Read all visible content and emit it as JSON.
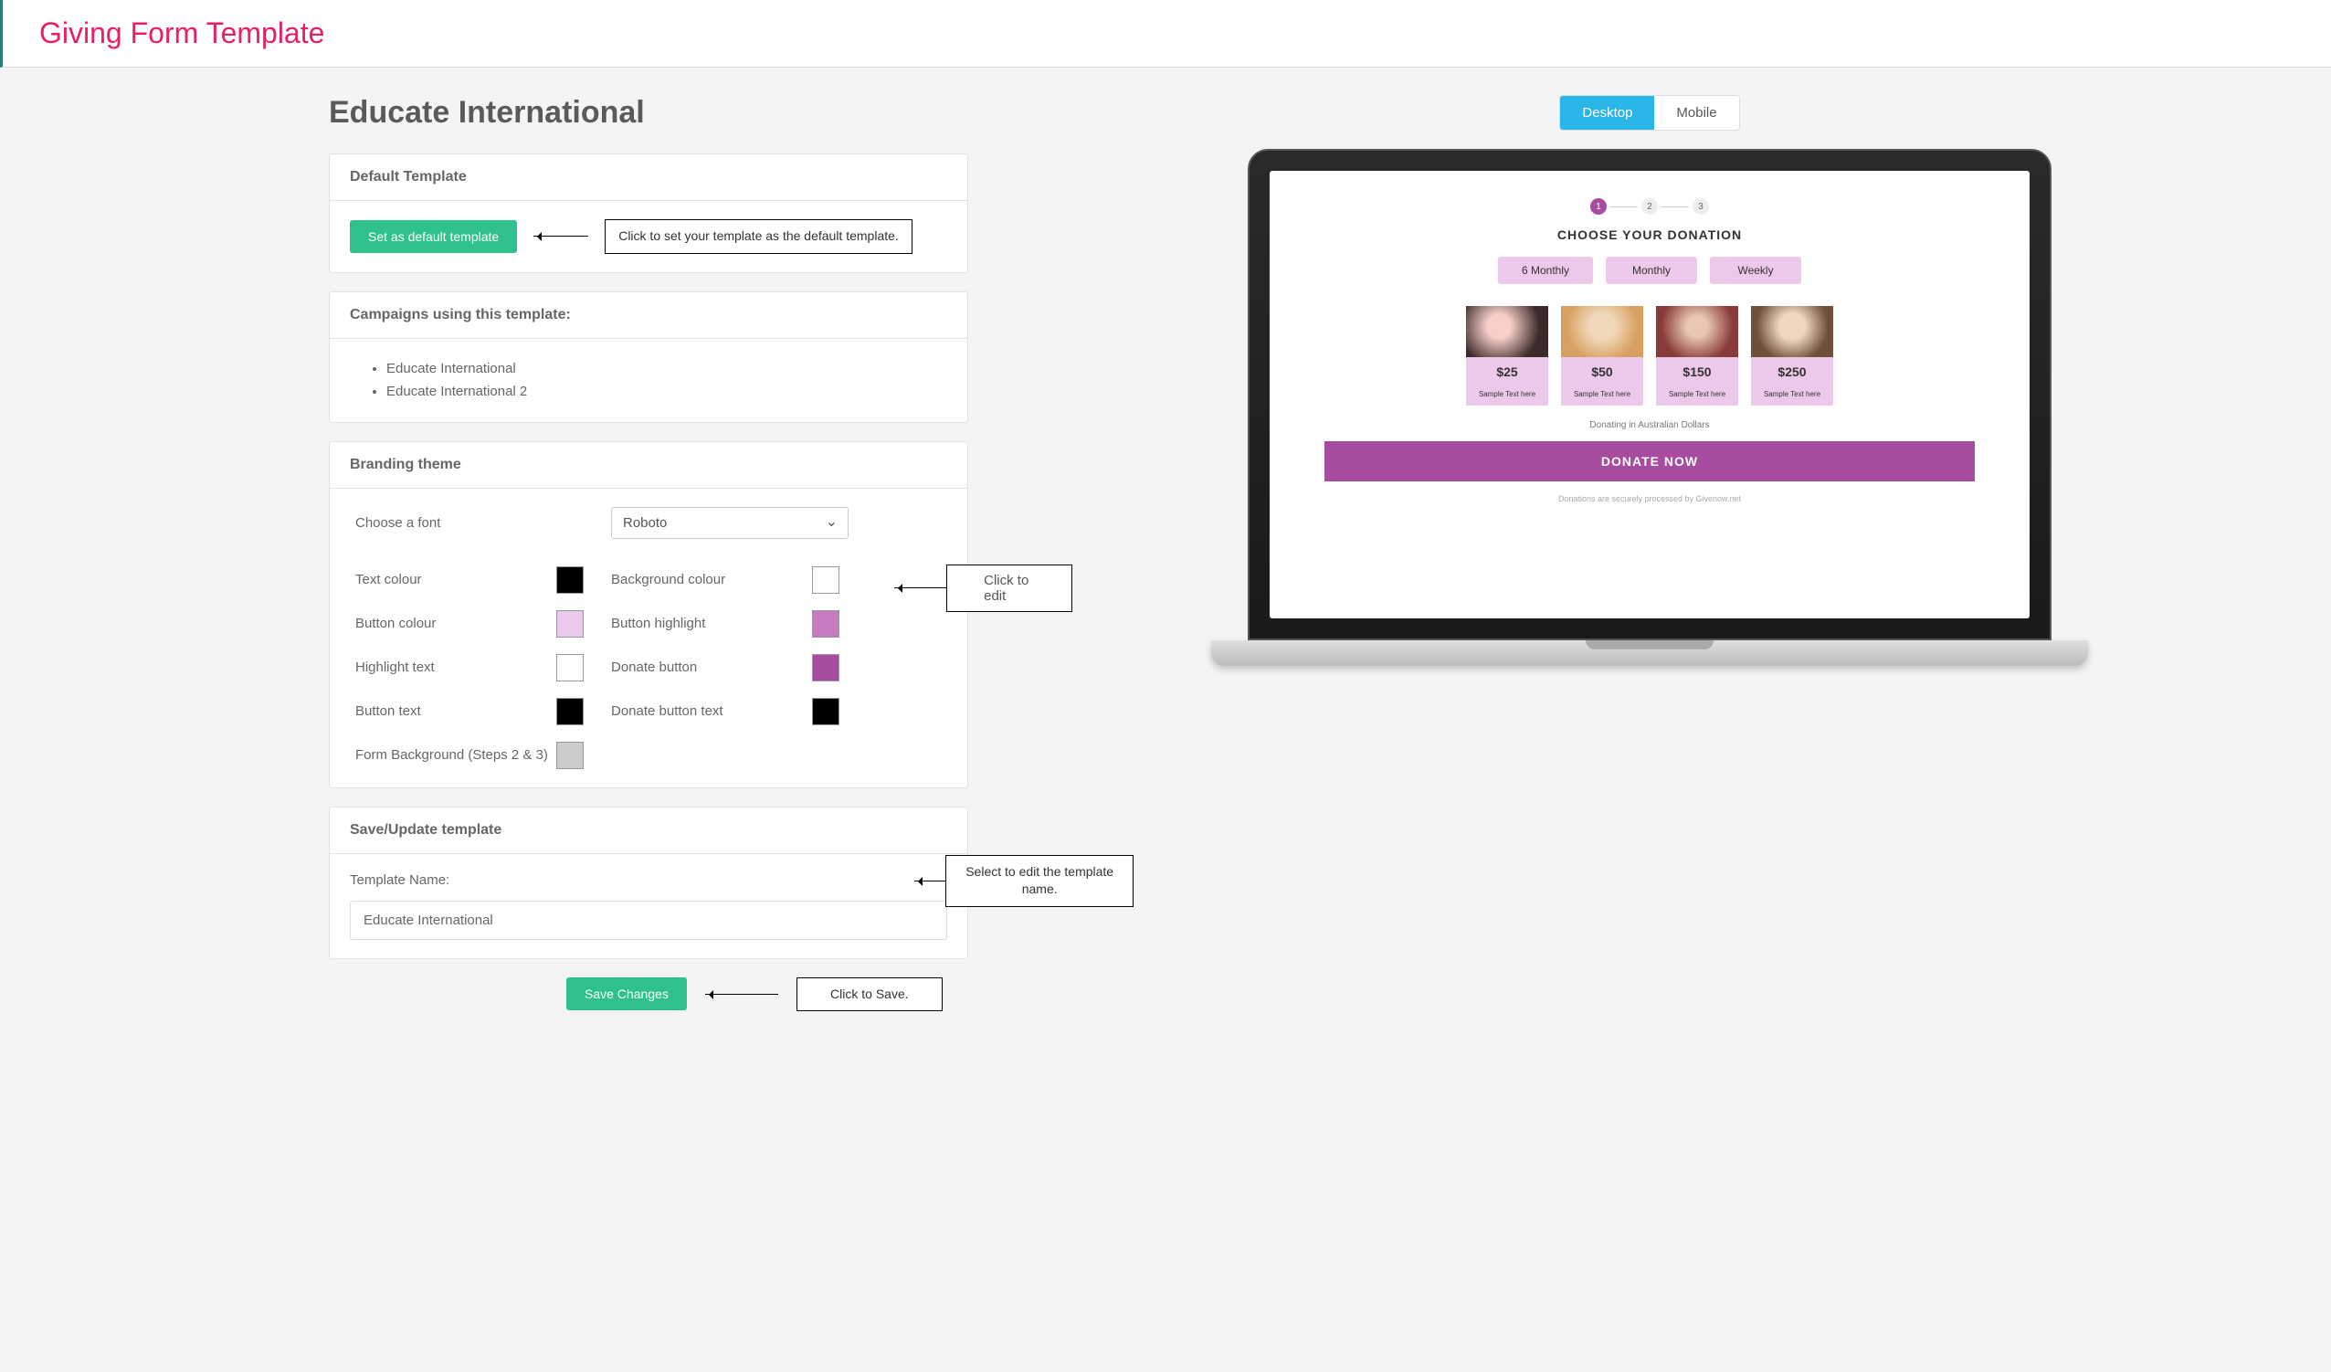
{
  "page": {
    "title": "Giving Form Template"
  },
  "org": {
    "name": "Educate International"
  },
  "defaultTemplate": {
    "header": "Default Template",
    "button": "Set as default template",
    "callout": "Click to set your template as the default template."
  },
  "campaigns": {
    "header": "Campaigns using this template:",
    "items": [
      "Educate International",
      "Educate International 2"
    ]
  },
  "branding": {
    "header": "Branding theme",
    "fontLabel": "Choose a font",
    "fontValue": "Roboto",
    "rows": {
      "textColour": {
        "label": "Text colour",
        "color": "#000000"
      },
      "bgColour": {
        "label": "Background colour",
        "color": "#ffffff"
      },
      "buttonColour": {
        "label": "Button colour",
        "color": "#ecc9ea"
      },
      "buttonHighlight": {
        "label": "Button highlight",
        "color": "#c67ac2"
      },
      "highlightText": {
        "label": "Highlight text",
        "color": "#ffffff"
      },
      "donateButton": {
        "label": "Donate button",
        "color": "#a84ca0"
      },
      "buttonText": {
        "label": "Button text",
        "color": "#000000"
      },
      "donateButtonText": {
        "label": "Donate button text",
        "color": "#000000"
      },
      "formBg": {
        "label": "Form Background (Steps 2 & 3)",
        "color": "#cccccc"
      }
    },
    "editCallout": "Click to edit"
  },
  "saveUpdate": {
    "header": "Save/Update template",
    "label": "Template Name:",
    "value": "Educate International",
    "callout": "Select to edit the template name."
  },
  "saveChanges": {
    "button": "Save Changes",
    "callout": "Click to Save."
  },
  "toggle": {
    "desktop": "Desktop",
    "mobile": "Mobile"
  },
  "preview": {
    "steps": [
      "1",
      "2",
      "3"
    ],
    "title": "CHOOSE YOUR DONATION",
    "freq": [
      "6 Monthly",
      "Monthly",
      "Weekly"
    ],
    "amounts": [
      {
        "price": "$25",
        "text": "Sample Text here"
      },
      {
        "price": "$50",
        "text": "Sample Text here"
      },
      {
        "price": "$150",
        "text": "Sample Text here"
      },
      {
        "price": "$250",
        "text": "Sample Text here"
      }
    ],
    "note": "Donating in Australian Dollars",
    "donate": "DONATE NOW",
    "footer": "Donations are securely processed by Givenow.net"
  }
}
